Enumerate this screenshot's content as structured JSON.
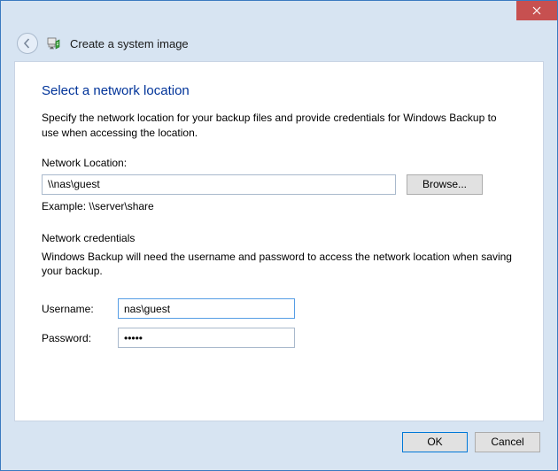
{
  "window": {
    "wizard_title": "Create a system image"
  },
  "page": {
    "heading": "Select a network location",
    "description": "Specify the network location for your backup files and provide credentials for Windows Backup to use when accessing the location.",
    "network_location_label": "Network Location:",
    "network_location_value": "\\\\nas\\guest",
    "browse_label": "Browse...",
    "example_text": "Example: \\\\server\\share",
    "credentials_section_label": "Network credentials",
    "credentials_description": "Windows Backup will need the username and password to access the network location when saving your backup.",
    "username_label": "Username:",
    "username_value": "nas\\guest",
    "password_label": "Password:",
    "password_value": "•••••"
  },
  "buttons": {
    "ok": "OK",
    "cancel": "Cancel"
  }
}
